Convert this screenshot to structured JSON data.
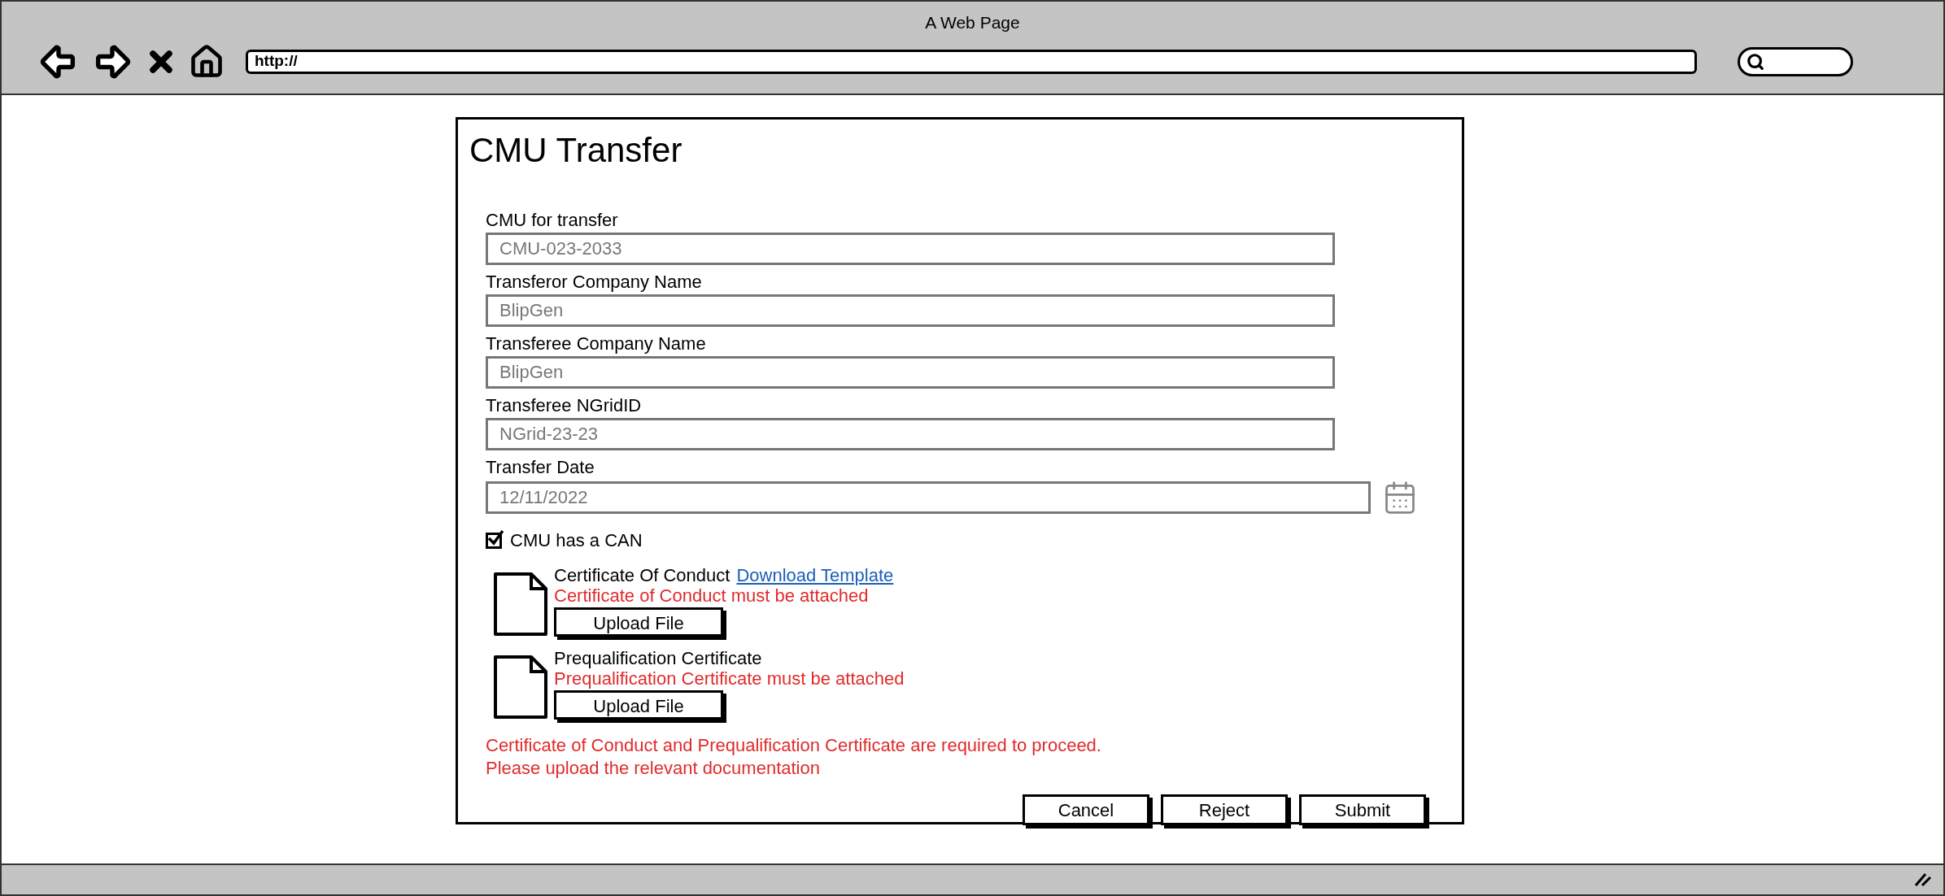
{
  "browser": {
    "title": "A Web Page",
    "url": "http://"
  },
  "form": {
    "title": "CMU Transfer",
    "fields": [
      {
        "label": "CMU for transfer",
        "value": "CMU-023-2033",
        "kind": "text"
      },
      {
        "label": "Transferor Company Name",
        "value": "BlipGen",
        "kind": "text"
      },
      {
        "label": "Transferee Company Name",
        "value": "BlipGen",
        "kind": "text"
      },
      {
        "label": "Transferee NGridID",
        "value": "NGrid-23-23",
        "kind": "text"
      },
      {
        "label": "Transfer Date",
        "value": "12/11/2022",
        "kind": "date"
      }
    ],
    "checkbox": {
      "label": "CMU has a CAN",
      "checked": true
    },
    "attachments": [
      {
        "title": "Certificate Of Conduct",
        "link": "Download Template",
        "error": "Certificate of Conduct must be attached",
        "button": "Upload File"
      },
      {
        "title": "Prequalification Certificate",
        "error": "Prequalification Certificate must be attached",
        "button": "Upload File"
      }
    ],
    "summary_error": [
      "Certificate of Conduct and Prequalification Certificate are required to proceed.",
      "Please upload the relevant documentation"
    ],
    "buttons": [
      "Cancel",
      "Reject",
      "Submit"
    ]
  }
}
